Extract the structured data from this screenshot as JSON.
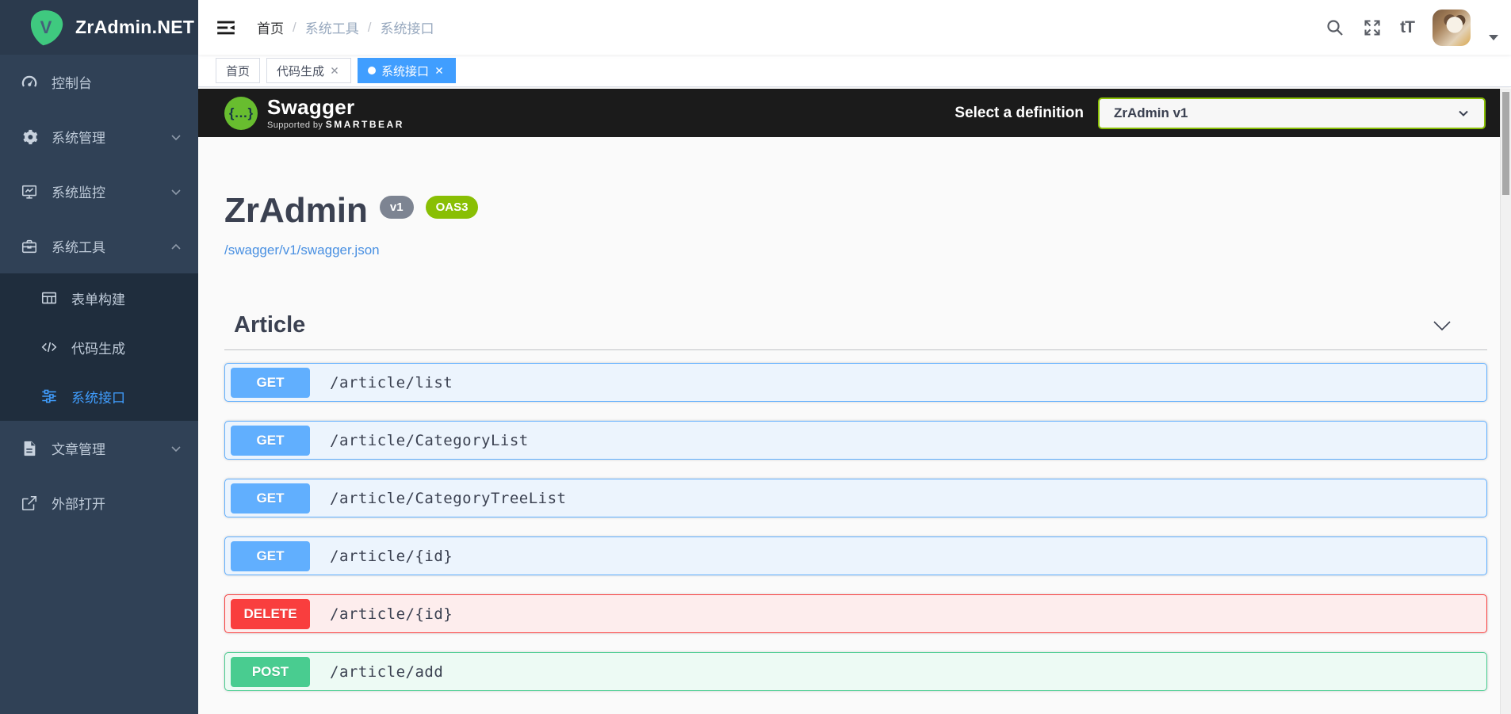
{
  "app": {
    "logo_text": "ZrAdmin.NET"
  },
  "sidebar": {
    "menu": [
      {
        "label": "控制台",
        "icon": "dashboard-icon"
      },
      {
        "label": "系统管理",
        "icon": "gear-icon",
        "chevron": "down"
      },
      {
        "label": "系统监控",
        "icon": "monitor-icon",
        "chevron": "down"
      },
      {
        "label": "系统工具",
        "icon": "toolbox-icon",
        "chevron": "up"
      },
      {
        "label": "表单构建",
        "icon": "table-icon",
        "sub": true
      },
      {
        "label": "代码生成",
        "icon": "code-icon",
        "sub": true
      },
      {
        "label": "系统接口",
        "icon": "sliders-icon",
        "sub": true,
        "active": true
      },
      {
        "label": "文章管理",
        "icon": "document-icon",
        "chevron": "down"
      },
      {
        "label": "外部打开",
        "icon": "external-link-icon"
      }
    ]
  },
  "header": {
    "breadcrumb": {
      "items": [
        "首页",
        "系统工具",
        "系统接口"
      ],
      "separator": "/"
    },
    "font_size_glyph": "tT"
  },
  "tabs": [
    {
      "label": "首页",
      "closable": false,
      "active": false
    },
    {
      "label": "代码生成",
      "closable": true,
      "active": false
    },
    {
      "label": "系统接口",
      "closable": true,
      "active": true
    }
  ],
  "swagger": {
    "logo_text": "Swagger",
    "supported_by": "Supported by",
    "supported_brand": "SMARTBEAR",
    "logo_glyph": "{…}",
    "select_label": "Select a definition",
    "selected_definition": "ZrAdmin v1",
    "title": "ZrAdmin",
    "version_badge": "v1",
    "oas_badge": "OAS3",
    "spec_url": "/swagger/v1/swagger.json",
    "section_title": "Article",
    "endpoints": [
      {
        "method": "GET",
        "path": "/article/list"
      },
      {
        "method": "GET",
        "path": "/article/CategoryList"
      },
      {
        "method": "GET",
        "path": "/article/CategoryTreeList"
      },
      {
        "method": "GET",
        "path": "/article/{id}"
      },
      {
        "method": "DELETE",
        "path": "/article/{id}"
      },
      {
        "method": "POST",
        "path": "/article/add"
      }
    ]
  },
  "colors": {
    "accent": "#409eff",
    "sidebar_bg": "#304156",
    "submenu_bg": "#1f2d3d",
    "swagger_topbar": "#1b1b1b",
    "swagger_green": "#89bf04",
    "get": "#61affe",
    "post": "#49cc90",
    "delete": "#f93e3e",
    "title_text": "#3b4151",
    "link": "#4990e2"
  }
}
